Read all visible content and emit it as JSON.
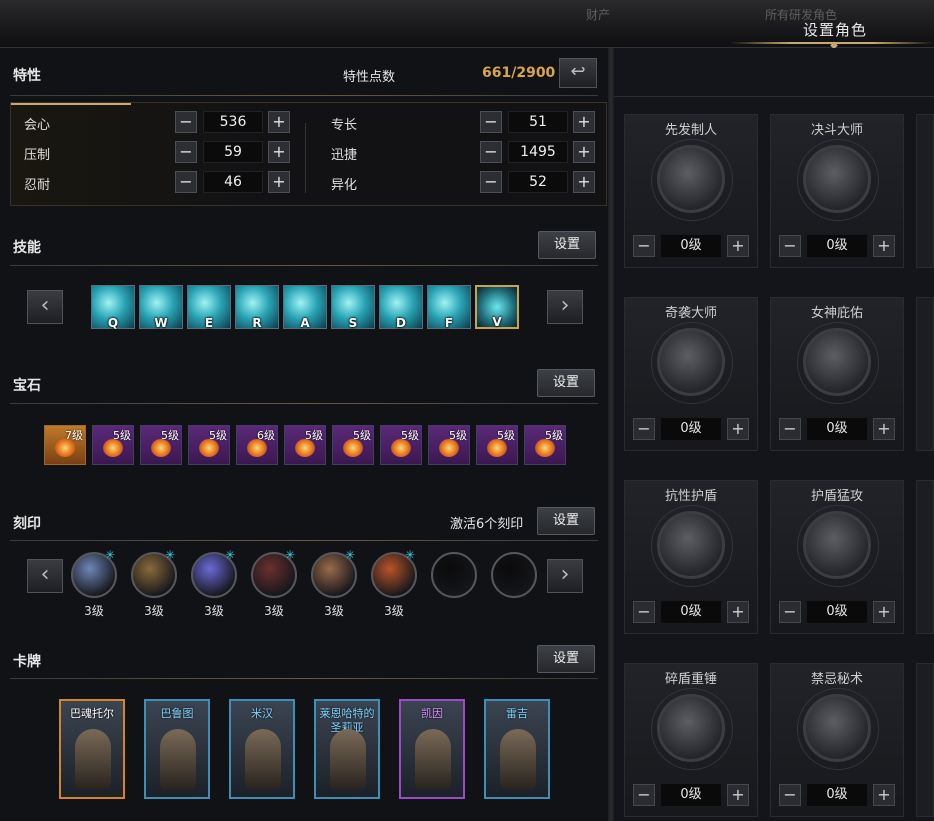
{
  "topbar": {
    "ghost_left": "财产",
    "ghost_right": "所有研发角色",
    "title": "设置角色"
  },
  "traits": {
    "title": "特性",
    "points_label": "特性点数",
    "points_value": "661/2900",
    "left": [
      {
        "label": "会心",
        "value": "536"
      },
      {
        "label": "压制",
        "value": "59"
      },
      {
        "label": "忍耐",
        "value": "46"
      }
    ],
    "right": [
      {
        "label": "专长",
        "value": "51"
      },
      {
        "label": "迅捷",
        "value": "1495"
      },
      {
        "label": "异化",
        "value": "52"
      }
    ]
  },
  "skills": {
    "title": "技能",
    "set_label": "设置",
    "keys": [
      "Q",
      "W",
      "E",
      "R",
      "A",
      "S",
      "D",
      "F",
      "V"
    ]
  },
  "gems": {
    "title": "宝石",
    "set_label": "设置",
    "levels": [
      "7级",
      "5级",
      "5级",
      "5级",
      "6级",
      "5级",
      "5级",
      "5级",
      "5级",
      "5级",
      "5级"
    ]
  },
  "engravings": {
    "title": "刻印",
    "active_label": "激活6个刻印",
    "set_label": "设置",
    "levels": [
      "3级",
      "3级",
      "3级",
      "3级",
      "3级",
      "3级",
      "",
      ""
    ]
  },
  "cards": {
    "title": "卡牌",
    "set_label": "设置",
    "names": [
      "巴魂托尔",
      "巴鲁图",
      "米汉",
      "莱恩哈特的\n圣莉亚",
      "凯因",
      "雷吉"
    ]
  },
  "nodes": [
    {
      "name": "先发制人",
      "level": "0级"
    },
    {
      "name": "决斗大师",
      "level": "0级"
    },
    {
      "name": "奇袭大师",
      "level": "0级"
    },
    {
      "name": "女神庇佑",
      "level": "0级"
    },
    {
      "name": "抗性护盾",
      "level": "0级"
    },
    {
      "name": "护盾猛攻",
      "level": "0级"
    },
    {
      "name": "碎盾重锤",
      "level": "0级"
    },
    {
      "name": "禁忌秘术",
      "level": "0级"
    }
  ],
  "controls": {
    "minus": "−",
    "plus": "+",
    "prev": "‹",
    "next": "›",
    "reset": "↩"
  }
}
